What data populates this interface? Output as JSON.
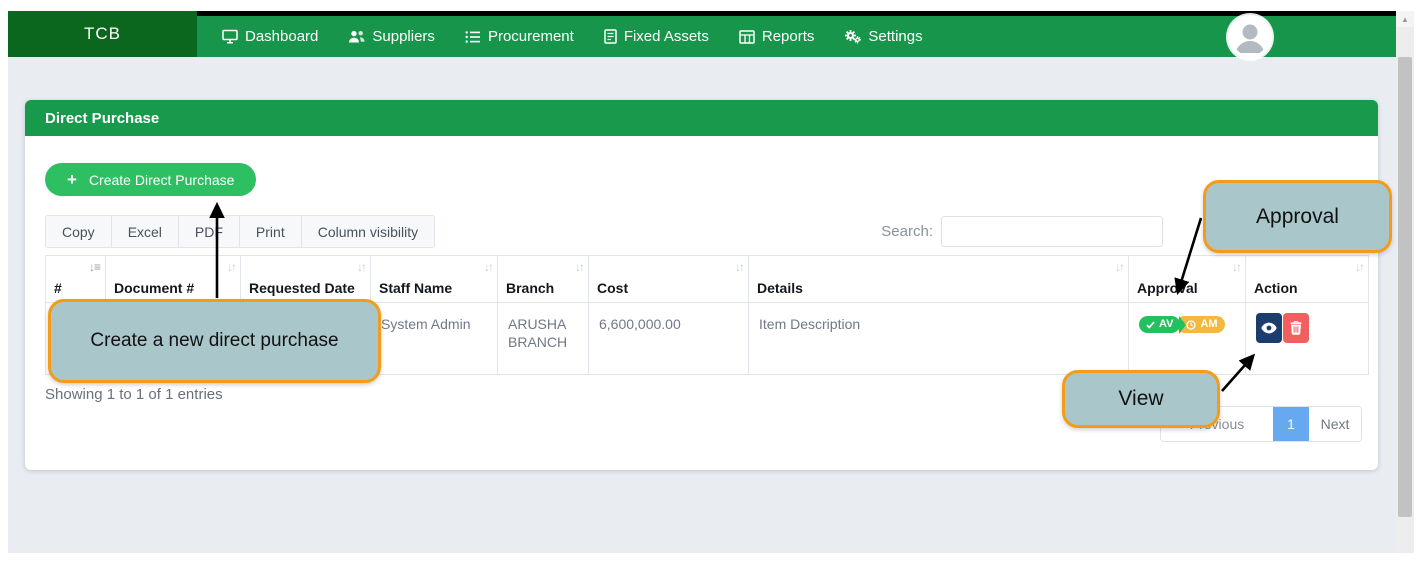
{
  "navbar": {
    "brand": "TCB",
    "items": [
      {
        "label": "Dashboard",
        "icon": "monitor-icon"
      },
      {
        "label": "Suppliers",
        "icon": "users-icon"
      },
      {
        "label": "Procurement",
        "icon": "list-icon"
      },
      {
        "label": "Fixed Assets",
        "icon": "ledger-icon"
      },
      {
        "label": "Reports",
        "icon": "table-icon"
      },
      {
        "label": "Settings",
        "icon": "cogs-icon"
      }
    ]
  },
  "panel": {
    "title": "Direct Purchase",
    "plus": "+",
    "create_button_label": "Create Direct Purchase",
    "export_buttons": [
      "Copy",
      "Excel",
      "PDF",
      "Print",
      "Column visibility"
    ],
    "search_label": "Search:",
    "search_value": ""
  },
  "table": {
    "columns": [
      "#",
      "Document #",
      "Requested Date",
      "Staff Name",
      "Branch",
      "Cost",
      "Details",
      "Approval",
      "Action"
    ],
    "sort_icon_active": "↓≡",
    "sort_icon": "↓↑",
    "row": {
      "number": "",
      "document": "",
      "requested_date": "",
      "staff_name": "System Admin",
      "branch": "ARUSHA BRANCH",
      "cost": "6,600,000.00",
      "details": "Item Description",
      "approval": [
        {
          "label": "AV",
          "status": "approved"
        },
        {
          "label": "AM",
          "status": "pending"
        }
      ]
    },
    "info": "Showing 1 to 1 of 1 entries"
  },
  "pagination": {
    "previous": "Previous",
    "current_page": "1",
    "next": "Next"
  },
  "annotations": {
    "approval_callout": "Approval",
    "create_callout": "Create a new direct purchase",
    "view_callout": "View"
  },
  "colors": {
    "brand_green": "#0a671d",
    "navbar_green": "#17964b",
    "header_green": "#189a4d",
    "button_green": "#2ebf63",
    "badge_green": "#22c05e",
    "badge_yellow": "#f3b83d",
    "view_button_navy": "#1b3d6d",
    "delete_button_red": "#f25f5f",
    "active_page_blue": "#66a9f0",
    "callout_fill": "#a9c6ca",
    "callout_border": "#f49c1a",
    "body_gray": "#e9edf2"
  }
}
